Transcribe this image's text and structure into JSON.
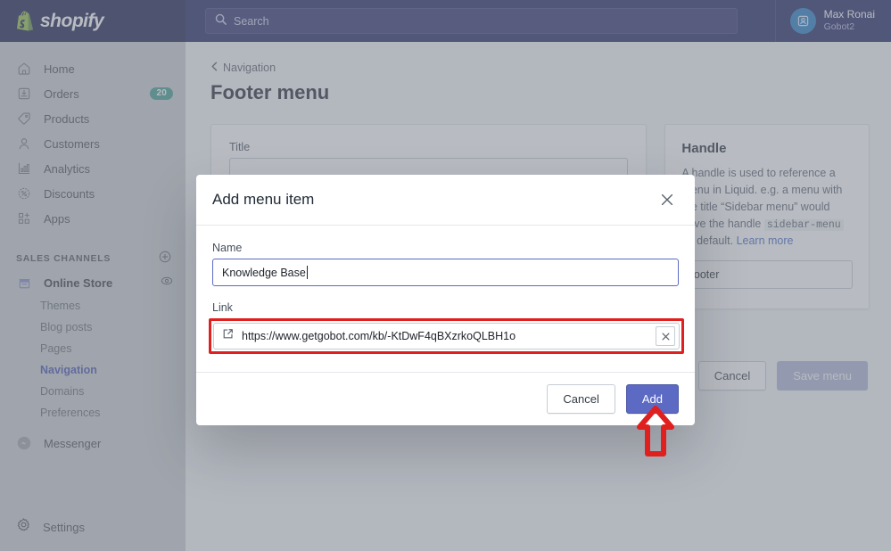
{
  "topbar": {
    "brand": "shopify",
    "brand_icon": "shopify-bag-icon",
    "search_placeholder": "Search",
    "search_value": "",
    "search_icon": "search-icon",
    "user_name": "Max Ronai",
    "user_shop": "Gobot2",
    "avatar_icon": "avatar-icon"
  },
  "sidebar": {
    "items": [
      {
        "label": "Home",
        "icon": "home-icon",
        "badge": ""
      },
      {
        "label": "Orders",
        "icon": "orders-icon",
        "badge": "20"
      },
      {
        "label": "Products",
        "icon": "products-tag-icon",
        "badge": ""
      },
      {
        "label": "Customers",
        "icon": "customers-person-icon",
        "badge": ""
      },
      {
        "label": "Analytics",
        "icon": "analytics-bars-icon",
        "badge": ""
      },
      {
        "label": "Discounts",
        "icon": "discounts-percent-icon",
        "badge": ""
      },
      {
        "label": "Apps",
        "icon": "apps-grid-plus-icon",
        "badge": ""
      }
    ],
    "sales_channels_header": "SALES CHANNELS",
    "sales_channels_add_icon": "plus-circle-icon",
    "online_store": {
      "label": "Online Store",
      "icon": "online-store-icon",
      "view_icon": "eye-icon"
    },
    "online_store_subitems": [
      {
        "label": "Themes",
        "active": false
      },
      {
        "label": "Blog posts",
        "active": false
      },
      {
        "label": "Pages",
        "active": false
      },
      {
        "label": "Navigation",
        "active": true
      },
      {
        "label": "Domains",
        "active": false
      },
      {
        "label": "Preferences",
        "active": false
      }
    ],
    "messenger": {
      "label": "Messenger",
      "icon": "messenger-icon"
    },
    "settings": {
      "label": "Settings",
      "icon": "gear-icon"
    }
  },
  "main": {
    "breadcrumb": "Navigation",
    "breadcrumb_icon": "chevron-left-icon",
    "page_title": "Footer menu",
    "title_card": {
      "label": "Title",
      "value": ""
    },
    "handle_card": {
      "heading": "Handle",
      "description_1": "A handle is used to reference a menu in Liquid. e.g. a menu with the title “Sidebar menu” would have the handle ",
      "code": "sidebar-menu",
      "description_2": " by default. ",
      "learn_more": "Learn more",
      "value": "footer"
    },
    "cancel_label": "Cancel",
    "save_label": "Save menu"
  },
  "modal": {
    "title": "Add menu item",
    "close_icon": "close-icon",
    "name_label": "Name",
    "name_value": "Knowledge Base",
    "link_label": "Link",
    "link_value": "https://www.getgobot.com/kb/-KtDwF4qBXzrkoQLBH1o",
    "link_external_icon": "external-link-icon",
    "link_clear_icon": "clear-x-icon",
    "cancel_label": "Cancel",
    "add_label": "Add"
  },
  "annotations": {
    "arrow_icon": "red-up-arrow-annotation",
    "highlight_color": "#e01f1f"
  },
  "colors": {
    "topbar": "#1c2260",
    "brand_block": "#151c4d",
    "sidebar": "#cbced3",
    "accent": "#5c6ac4",
    "badge": "#3d9b8f",
    "link": "#3f69c4",
    "annotation_red": "#e01f1f"
  }
}
